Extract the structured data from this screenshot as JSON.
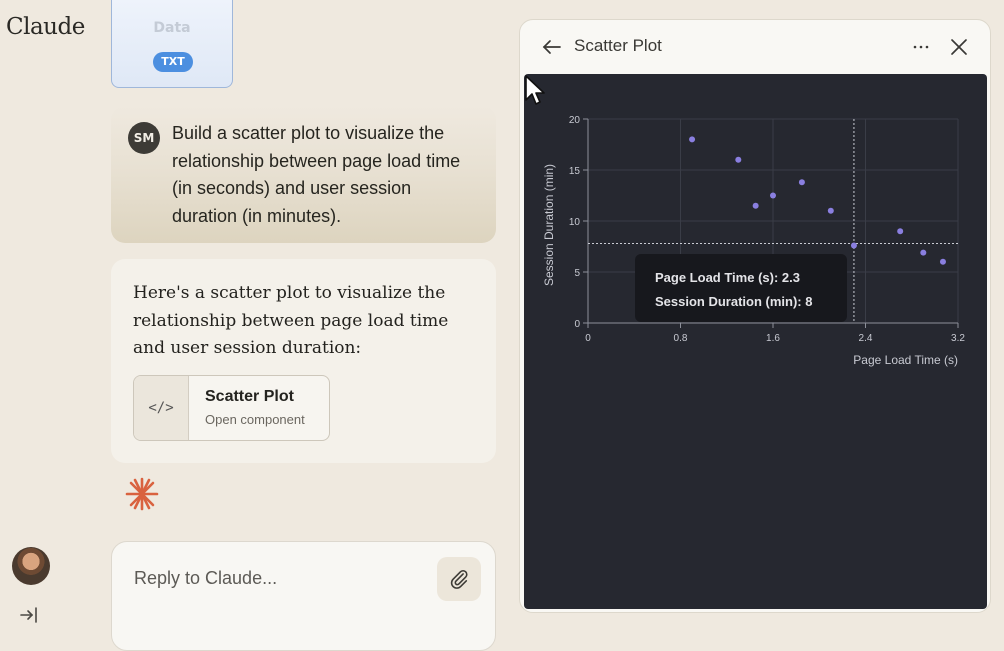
{
  "app": {
    "logo": "Claude"
  },
  "attachment": {
    "title": "Data",
    "badge": "TXT"
  },
  "user_message": {
    "initials": "SM",
    "text": "Build a scatter plot to visualize the relationship between page load time (in seconds) and user session duration (in minutes)."
  },
  "assistant_message": {
    "text": "Here's a scatter plot to visualize the relationship between page load time and user session duration:",
    "component": {
      "title": "Scatter Plot",
      "subtitle": "Open component",
      "icon": "code-icon"
    }
  },
  "reply": {
    "placeholder": "Reply to Claude..."
  },
  "panel": {
    "title": "Scatter Plot",
    "tooltip": {
      "line1": "Page Load Time (s): 2.3",
      "line2": "Session Duration (min): 8"
    }
  },
  "colors": {
    "background": "#efe9df",
    "plot_background": "#262830",
    "point": "#8a7fe0",
    "accent_spark": "#d9623f",
    "badge": "#4c8fe0"
  },
  "chart_data": {
    "type": "scatter",
    "title": "",
    "xlabel": "Page Load Time (s)",
    "ylabel": "Session Duration (min)",
    "xlim": [
      0,
      3.2
    ],
    "ylim": [
      0,
      20
    ],
    "xticks": [
      "0",
      "0.8",
      "1.6",
      "2.4",
      "3.2"
    ],
    "yticks": [
      "0",
      "5",
      "10",
      "15",
      "20"
    ],
    "grid": true,
    "points": [
      {
        "x": 0.9,
        "y": 18
      },
      {
        "x": 1.3,
        "y": 16
      },
      {
        "x": 1.45,
        "y": 11.5
      },
      {
        "x": 1.6,
        "y": 12.5
      },
      {
        "x": 1.85,
        "y": 13.8
      },
      {
        "x": 2.1,
        "y": 11
      },
      {
        "x": 2.3,
        "y": 7.6
      },
      {
        "x": 2.7,
        "y": 9
      },
      {
        "x": 2.9,
        "y": 6.9
      },
      {
        "x": 3.07,
        "y": 6
      }
    ],
    "hover": {
      "x": 2.3,
      "y": 7.8
    }
  }
}
